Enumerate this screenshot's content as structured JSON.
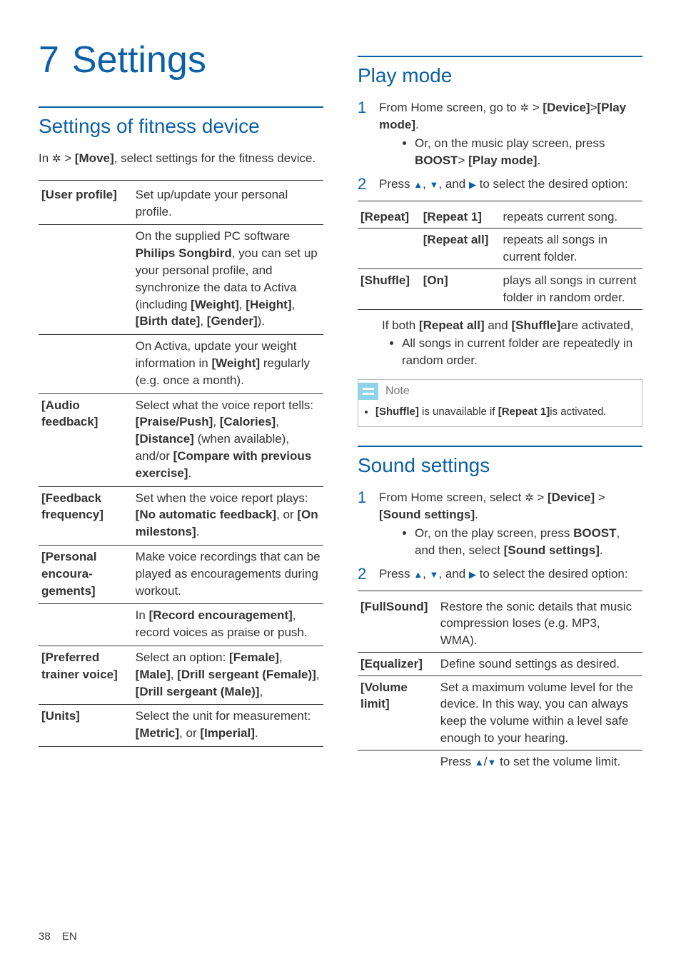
{
  "chapter": {
    "num": "7",
    "title": "Settings"
  },
  "fitness": {
    "heading": "Settings of fitness device",
    "intro_pre": "In ",
    "intro_mid": " > ",
    "intro_move": "[Move]",
    "intro_post": ", select settings for the fitness device.",
    "rows": {
      "user_profile_key": "[User profile]",
      "user_profile_1": "Set up/update your personal profile.",
      "user_profile_2a": "On the supplied PC software ",
      "user_profile_2b": "Philips Songbird",
      "user_profile_2c": ", you can set up your personal profile, and synchronize the data to Activa (including ",
      "user_profile_2d": "[Weight]",
      "user_profile_2e": ", ",
      "user_profile_2f": "[Height]",
      "user_profile_2g": ", ",
      "user_profile_2h": "[Birth date]",
      "user_profile_2i": ", ",
      "user_profile_2j": "[Gender]",
      "user_profile_2k": ").",
      "user_profile_3a": "On Activa, update your weight information in ",
      "user_profile_3b": "[Weight]",
      "user_profile_3c": " regularly (e.g. once a month).",
      "audio_key": "[Audio feedback]",
      "audio_a": "Select what the voice report tells: ",
      "audio_b": "[Praise/Push]",
      "audio_c": ", ",
      "audio_d": "[Calories]",
      "audio_e": ", ",
      "audio_f": "[Distance]",
      "audio_g": " (when available), and/or ",
      "audio_h": "[Compare with previous exercise]",
      "audio_i": ".",
      "freq_key": "[Feedback frequency]",
      "freq_a": "Set when the voice report plays: ",
      "freq_b": "[No automatic feedback]",
      "freq_c": ", or ",
      "freq_d": "[On milestons]",
      "freq_e": ".",
      "enc_key": "[Personal encoura-gements]",
      "enc_1": "Make voice recordings that can be played as encouragements during workout.",
      "enc_2a": "In ",
      "enc_2b": "[Record encouragement]",
      "enc_2c": ", record voices as praise or push.",
      "voice_key": "[Preferred trainer voice]",
      "voice_a": "Select an option: ",
      "voice_b": "[Female]",
      "voice_c": ", ",
      "voice_d": "[Male]",
      "voice_e": ", ",
      "voice_f": "[Drill sergeant (Female)]",
      "voice_g": ", ",
      "voice_h": "[Drill sergeant (Male)]",
      "voice_i": ",",
      "units_key": "[Units]",
      "units_a": "Select the unit for measurement: ",
      "units_b": "[Metric]",
      "units_c": ", or ",
      "units_d": "[Imperial]",
      "units_e": "."
    }
  },
  "playmode": {
    "heading": "Play mode",
    "step1a": "From Home screen, go to ",
    "step1b": " > ",
    "step1c": "[Device]",
    "step1d": ">",
    "step1e": "[Play mode]",
    "step1f": ".",
    "sub1a": "Or, on the music play screen, press ",
    "sub1b": "BOOST",
    "sub1c": "> ",
    "sub1d": "[Play mode]",
    "sub1e": ".",
    "step2a": "Press ",
    "step2b": ", ",
    "step2c": ", and ",
    "step2d": " to select the desired option:",
    "tbl": {
      "repeat": "[Repeat]",
      "repeat1": "[Repeat 1]",
      "repeat1_desc": "repeats current song.",
      "repeatall": "[Repeat all]",
      "repeatall_desc": "repeats all songs in current folder.",
      "shuffle": "[Shuffle]",
      "on": "[On]",
      "on_desc": "plays all songs in current folder in random order."
    },
    "both_a": "If both ",
    "both_b": "[Repeat all]",
    "both_c": " and ",
    "both_d": "[Shuffle]",
    "both_e": "are activated,",
    "both_bullet": "All songs in current folder are repeatedly in random order.",
    "note_label": "Note",
    "note_a": "[Shuffle]",
    "note_b": " is unavailable if ",
    "note_c": "[Repeat 1]",
    "note_d": "is activated."
  },
  "sound": {
    "heading": "Sound settings",
    "step1a": "From Home screen, select ",
    "step1b": " > ",
    "step1c": "[Device]",
    "step1d": " > ",
    "step1e": "[Sound settings]",
    "step1f": ".",
    "sub1a": "Or, on the play screen, press ",
    "sub1b": "BOOST",
    "sub1c": ", and then, select ",
    "sub1d": "[Sound settings]",
    "sub1e": ".",
    "step2a": "Press ",
    "step2b": ", ",
    "step2c": ", and ",
    "step2d": " to select the desired option:",
    "tbl": {
      "fullsound": "[FullSound]",
      "fullsound_desc": "Restore the sonic details that music compression loses (e.g. MP3, WMA).",
      "equalizer": "[Equalizer]",
      "equalizer_desc": "Define sound settings as desired.",
      "volume": "[Volume limit]",
      "volume_desc": "Set a maximum volume level for the device. In this way, you can always keep the volume within a level safe enough to your hearing.",
      "volume_desc2a": "Press ",
      "volume_desc2b": " to set the volume limit."
    }
  },
  "footer": {
    "page": "38",
    "lang": "EN"
  }
}
